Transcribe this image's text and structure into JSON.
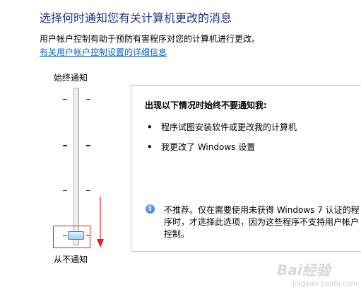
{
  "header": {
    "title": "选择何时通知您有关计算机更改的消息",
    "description": "用户帐户控制有助于预防有害程序对您的计算机进行更改。",
    "link": "有关用户帐户控制设置的详细信息"
  },
  "slider": {
    "top_label": "始终通知",
    "bottom_label": "从不通知",
    "level_index": 0,
    "level_count": 4
  },
  "panel": {
    "header": "出现以下情况时始终不要通知我:",
    "bullets": [
      "程序试图安装软件或更改我的计算机",
      "我更改了 Windows 设置"
    ],
    "note": "不推荐。仅在需要使用未获得 Windows 7 认证的程序时，才选择此选项，因为这些程序不支持用户帐户控制。"
  },
  "watermark": {
    "brand": "Bai经验",
    "sub": "jingyan.baidu.com"
  },
  "colors": {
    "title": "#1e3287",
    "link": "#0a64b4",
    "annotation": "#e02020"
  }
}
